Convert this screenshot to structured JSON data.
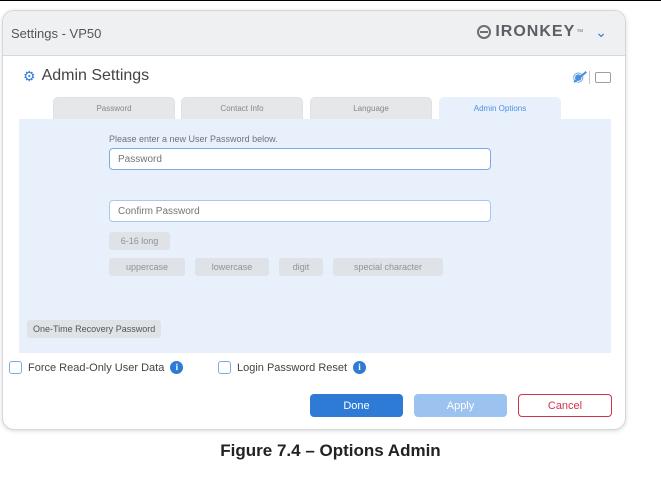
{
  "window": {
    "title": "Settings - VP50"
  },
  "brand": {
    "name": "IRONKEY",
    "tm": "™",
    "icon": "ironkey-logo-icon",
    "menu_icon": "chevron-down-icon"
  },
  "admin": {
    "title": "Admin Settings",
    "icon": "gear-icon"
  },
  "toolbar": {
    "icons": [
      "eye-off-icon",
      "keyboard-icon"
    ]
  },
  "tabs": [
    {
      "label": "Password",
      "active": false
    },
    {
      "label": "Contact Info",
      "active": false
    },
    {
      "label": "Language",
      "active": false
    },
    {
      "label": "Admin Options",
      "active": true
    }
  ],
  "form": {
    "instruction": "Please enter a new User Password below.",
    "password_placeholder": "Password",
    "confirm_placeholder": "Confirm Password",
    "requirements": {
      "length": "6-16 long",
      "items": [
        "uppercase",
        "lowercase",
        "digit",
        "special character"
      ]
    },
    "otrp_label": "One-Time Recovery Password"
  },
  "options": [
    {
      "label": "Force Read-Only User Data",
      "checked": false,
      "info": "i"
    },
    {
      "label": "Login Password Reset",
      "checked": false,
      "info": "i"
    }
  ],
  "buttons": {
    "done": "Done",
    "apply": "Apply",
    "cancel": "Cancel"
  },
  "caption": "Figure 7.4 – Options Admin",
  "colors": {
    "accent": "#2e7bd6",
    "panel": "#e8f1fb",
    "cancel": "#d1334e",
    "apply_disabled": "#9cc2ef"
  }
}
